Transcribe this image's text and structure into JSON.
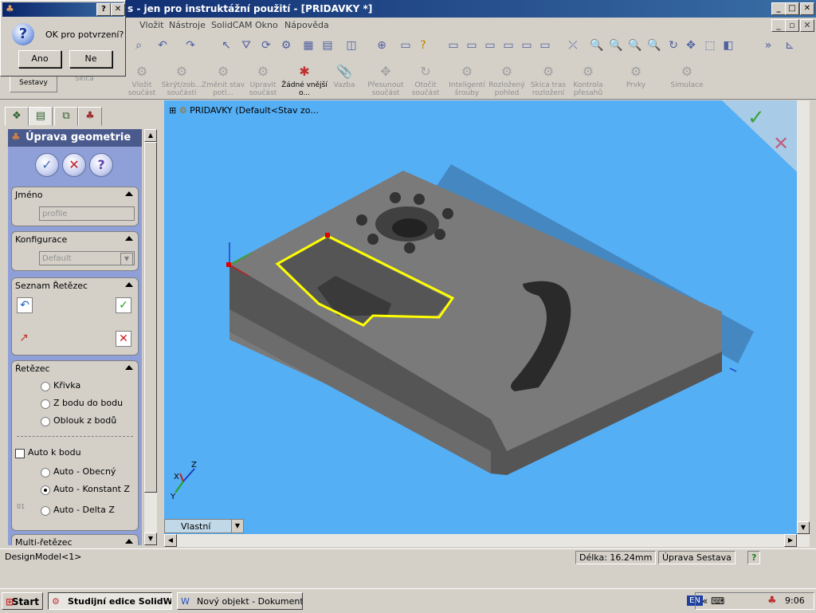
{
  "window": {
    "title": "s - jen pro instruktážní použití - [PRIDAVKY *]"
  },
  "menu": [
    "Vložit",
    "Nástroje",
    "SolidCAM",
    "Okno",
    "Nápověda"
  ],
  "toolbar2": [
    {
      "label": "Sestavy",
      "active": true
    },
    {
      "label": "Skica",
      "active": false
    },
    {
      "label": "Vložit součást",
      "active": false
    },
    {
      "label": "Skrýt/zob... součásti",
      "active": false
    },
    {
      "label": "Změnit stav potl...",
      "active": false
    },
    {
      "label": "Upravit součást",
      "active": false
    },
    {
      "label": "Žádné vnější o...",
      "active": true
    },
    {
      "label": "Vazba",
      "active": false
    },
    {
      "label": "Přesunout součást",
      "active": false
    },
    {
      "label": "Otočit součást",
      "active": false
    },
    {
      "label": "Inteligentí šrouby",
      "active": false
    },
    {
      "label": "Rozložený pohled",
      "active": false
    },
    {
      "label": "Skica tras rozložení",
      "active": false
    },
    {
      "label": "Kontrola přesahů",
      "active": false
    },
    {
      "label": "Prvky",
      "active": false
    },
    {
      "label": "Simulace",
      "active": false
    }
  ],
  "panel": {
    "title": "Úprava geometrie",
    "name_group": {
      "label": "Jméno",
      "value": "profile"
    },
    "config_group": {
      "label": "Konfigurace",
      "value": "Default"
    },
    "chainlist_group": {
      "label": "Seznam Řetězec"
    },
    "chain_group": {
      "label": "Řetězec",
      "options": [
        "Křivka",
        "Z bodu do bodu",
        "Oblouk z bodů"
      ],
      "auto_label": "Auto k bodu",
      "auto_options": [
        "Auto - Obecný",
        "Auto - Konstant Z",
        "Auto - Delta Z"
      ],
      "auto_selected": 1,
      "auto_extra": "01"
    },
    "multi_group": {
      "label": "Multi-řetězec"
    }
  },
  "viewport": {
    "tree_label": "PRIDAVKY  (Default<Stav zo...",
    "view_combo": "Vlastní"
  },
  "status": {
    "left": "DesignModel<1>",
    "length": "Délka: 16.24mm",
    "mode": "Úprava Sestava",
    "help": "?"
  },
  "dialog": {
    "question": "OK pro potvrzení?",
    "yes": "Ano",
    "no": "Ne",
    "help": "?",
    "close": "✕"
  },
  "taskbar": {
    "start": "Start",
    "task1": "Studijní edice SolidW...",
    "task2": "Nový objekt - Dokument ...",
    "lang": "EN",
    "time": "9:06",
    "chevron": "«"
  },
  "axes": {
    "x": "X",
    "y": "Y",
    "z": "Z"
  }
}
